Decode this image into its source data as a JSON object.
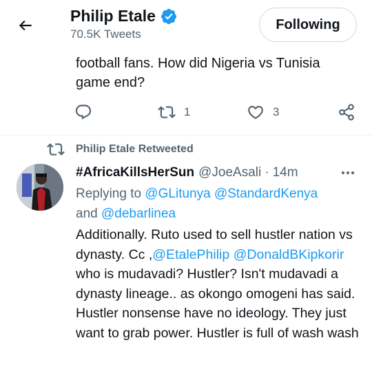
{
  "header": {
    "name": "Philip Etale",
    "tweet_count": "70.5K Tweets",
    "follow_label": "Following"
  },
  "prev_tweet": {
    "text": "football fans. How did Nigeria vs Tunisia game end?",
    "reply_count": "",
    "retweet_count": "1",
    "like_count": "3"
  },
  "retweet_header": {
    "label": "Philip Etale Retweeted"
  },
  "tweet": {
    "author": "#AfricaKillsHerSun",
    "handle": "@JoeAsali",
    "separator": "·",
    "time": "14m",
    "replying_prefix": "Replying to",
    "mentions": [
      "@GLitunya",
      "@StandardKenya",
      "@debarlinea"
    ],
    "and_word": "and",
    "body_1": "Additionally.  Ruto used to sell hustler nation vs dynasty.  Cc ,",
    "body_mention_1": "@EtalePhilip",
    "body_mention_2": "@DonaldBKipkorir",
    "body_2": " who is mudavadi? Hustler? Isn't mudavadi a dynasty lineage.. as okongo omogeni has said. Hustler nonsense have no ideology.  They just want to grab power. Hustler is full of wash wash"
  },
  "colors": {
    "accent": "#1d9bf0",
    "secondary_text": "#536471",
    "primary_text": "#0f1419",
    "border": "#cfd9de"
  },
  "icons": [
    "back-arrow-icon",
    "verified-badge-icon",
    "reply-icon",
    "retweet-icon",
    "like-icon",
    "share-icon",
    "more-icon"
  ]
}
